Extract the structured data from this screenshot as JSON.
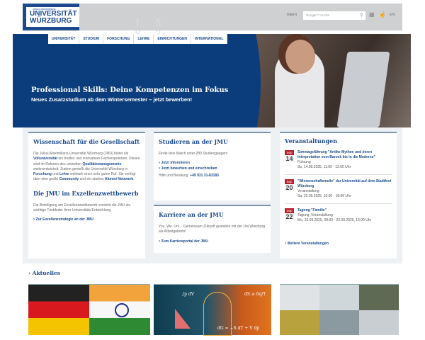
{
  "header": {
    "logo_small": "Julius-Maximilians-",
    "logo_line1": "UNIVERSITÄT",
    "logo_line2": "WÜRZBURG",
    "seal_text": "15 83",
    "intern": "Intern",
    "search_placeholder": "Google™ Suche",
    "lang": "EN"
  },
  "nav": [
    "UNIVERSITÄT",
    "STUDIUM",
    "FORSCHUNG",
    "LEHRE",
    "EINRICHTUNGEN",
    "INTERNATIONAL"
  ],
  "hero": {
    "title": "Professional Skills: Deine Kompetenzen im Fokus",
    "subtitle": "Neues Zusatzstudium ab dem Wintersemester – jetzt bewerben!"
  },
  "wiss": {
    "title": "Wissenschaft für die Gesellschaft",
    "t1": "Die Julius-Maximilians-Universität Würzburg (JMU) bietet als ",
    "l1": "Volluniversität",
    "t2": " ein breites und innovatives Fächerspektrum. Dieses wird im Rahmen des uniweiten ",
    "l2": "Qualitätsmanagements",
    "t3": " weiterentwickelt. Zudem genießt die Universität Würzburg in ",
    "l3": "Forschung",
    "t4": " und ",
    "l4": "Lehre",
    "t5": " weltweit einen sehr guten Ruf. Sie verfügt über eine große ",
    "l5": "Community",
    "t6": " und ein starkes ",
    "l6": "Alumni Netzwerk",
    "t7": "."
  },
  "exz": {
    "title": "Die JMU im Exzellenzwettbewerb",
    "text": "Die Beteiligung am Exzellenzwettbewerb versteht die JMU als wichtige Triebfeder ihrer Universitäts-Entwicklung.",
    "link": "Zur Exzellenzstrategie an der JMU"
  },
  "stud": {
    "title": "Studieren an der JMU",
    "text": "Finde dein Match unter 280 Studiengängen!",
    "link1": "Jetzt informieren",
    "link2": "Jetzt bewerben und einschreiben",
    "help": "Hilfe und Beratung: ",
    "phone": "+49 931 31-83183"
  },
  "karr": {
    "title": "Karriere an der JMU",
    "text": "You. We. Uni. - Gemeinsam Zukunft gestalten mit der Uni Würzburg als Arbeitgeberin!",
    "link": "Zum Karriereportal der JMU"
  },
  "events": {
    "title": "Veranstaltungen",
    "items": [
      {
        "month": "Sep",
        "day": "14",
        "title": "Sonntagsführung \"Antike Mythen und deren Interpretation vom Barock bis in die Moderne\"",
        "type": "Führung",
        "time": "So, 14.09.2025, 11:00 - 12:00 Uhr"
      },
      {
        "month": "Sep",
        "day": "20",
        "title": "\"Wissenschaftsmeile\" der Universität auf dem Stadtfest Würzburg",
        "type": "Veranstaltung",
        "time": "Sa, 20.09.2025, 10:00 - 18:00 Uhr"
      },
      {
        "month": "Sep",
        "day": "22",
        "title": "Tagung \"Familie\"",
        "type": "Tagung, Veranstaltung",
        "time": "Mo, 22.09.2025, 08:00 - 23.09.2025, 16:00 Uhr"
      }
    ],
    "more": "Weitere Veranstaltungen"
  },
  "news": {
    "title": "Aktuelles",
    "formula1": "∫p dV",
    "formula2": "dS ≥ δq/T",
    "formula3": "dG = −S dT + V dp"
  }
}
